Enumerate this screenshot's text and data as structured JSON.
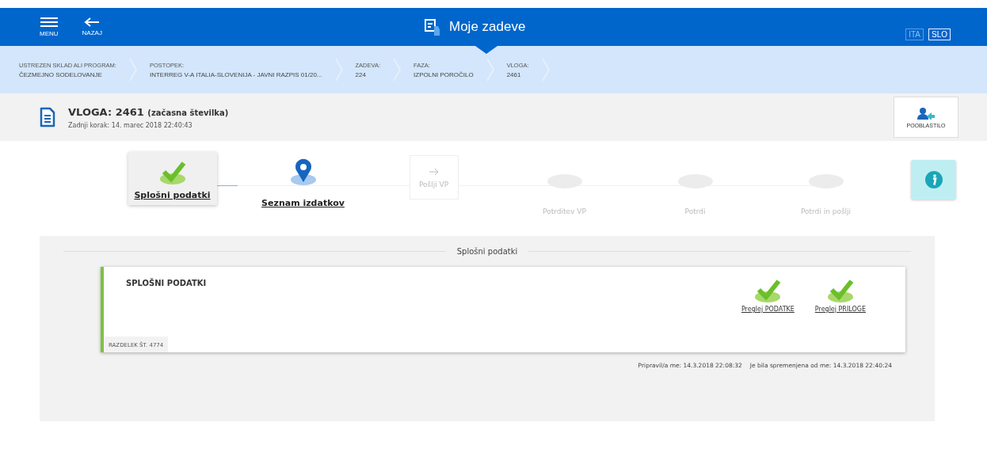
{
  "header": {
    "menu_label": "MENU",
    "back_label": "NAZAJ",
    "title": "Moje zadeve",
    "languages": [
      {
        "label": "ITA",
        "selected": false
      },
      {
        "label": "SLO",
        "selected": true
      }
    ]
  },
  "breadcrumb": [
    {
      "label": "USTREZEN SKLAD ALI PROGRAM:",
      "value": "ČEZMEJNO SODELOVANJE"
    },
    {
      "label": "POSTOPEK:",
      "value": "INTERREG V-A ITALIA-SLOVENIJA - JAVNI RAZPIS 01/20..."
    },
    {
      "label": "ZADEVA:",
      "value": "224"
    },
    {
      "label": "FAZA:",
      "value": "IZPOLNI POROČILO"
    },
    {
      "label": "VLOGA:",
      "value": "2461"
    }
  ],
  "document": {
    "title": "VLOGA: 2461",
    "title_note": "(začasna številka)",
    "last_step": "Zadnji korak: 14. marec 2018 22:40:43",
    "delegate_button": "POOBLASTILO"
  },
  "steps": [
    {
      "label": "Splošni podatki",
      "kind": "done"
    },
    {
      "label": "Seznam izdatkov",
      "kind": "current"
    },
    {
      "label": "Pošlji VP",
      "kind": "next"
    },
    {
      "label": "Potrditev VP",
      "kind": "pending"
    },
    {
      "label": "Potrdi",
      "kind": "pending"
    },
    {
      "label": "Potrdi in pošlji",
      "kind": "pending"
    }
  ],
  "section": {
    "heading": "Splošni podatki",
    "card": {
      "title": "SPLOŠNI PODATKI",
      "section_number": "RAZDELEK ŠT. 4774",
      "actions": [
        {
          "label": "Preglej PODATKE",
          "done": true
        },
        {
          "label": "Preglej PRILOGE",
          "done": true
        }
      ]
    },
    "prepared": "Pripravil/a me: 14.3.2018 22:08:32",
    "modified": "Je bila spremenjena od me: 14.3.2018 22:40:24"
  }
}
